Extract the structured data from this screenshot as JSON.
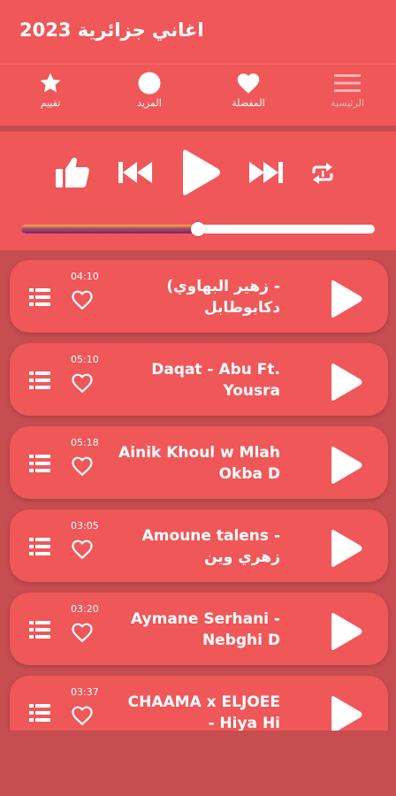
{
  "app": {
    "title": "اغاني جزائرية 2023"
  },
  "tabs": [
    {
      "label": "الرئيسية",
      "icon": "menu-icon"
    },
    {
      "label": "المفضلة",
      "icon": "heart-icon"
    },
    {
      "label": "المزيد",
      "icon": "circle-icon"
    },
    {
      "label": "تقييم",
      "icon": "star-icon"
    }
  ],
  "player": {
    "controls": [
      "like-icon",
      "previous-icon",
      "play-icon",
      "next-icon",
      "repeat-icon"
    ],
    "progress": 0.5
  },
  "songs": [
    {
      "title": "(زهير البهاوي -\nدكابوطابل",
      "duration": "04:10"
    },
    {
      "title": "Daqat - Abu Ft.\nYousra",
      "duration": "05:10"
    },
    {
      "title": "Ainik Khoul w Mlah\nOkba D",
      "duration": "05:18"
    },
    {
      "title": "Amoune talens -\nزهري وين",
      "duration": "03:05"
    },
    {
      "title": "Aymane Serhani -\nNebghi D",
      "duration": "03:20"
    },
    {
      "title": "CHAAMA x ELJOEE\n- Hiya Hi",
      "duration": "03:37"
    }
  ],
  "colors": {
    "primary": "#ef5759",
    "background": "#c64d50"
  }
}
